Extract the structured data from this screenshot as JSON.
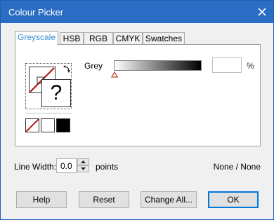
{
  "window": {
    "title": "Colour Picker"
  },
  "tabs": [
    {
      "label": "Greyscale",
      "active": true
    },
    {
      "label": "HSB",
      "active": false
    },
    {
      "label": "RGB",
      "active": false
    },
    {
      "label": "CMYK",
      "active": false
    },
    {
      "label": "Swatches",
      "active": false
    }
  ],
  "greyscale": {
    "grey_label": "Grey",
    "grey_value": "",
    "unit": "%",
    "preview_unknown": "?",
    "slider_position": 0.0
  },
  "line_width": {
    "label": "Line Width:",
    "value": "0.0",
    "unit": "points"
  },
  "status_text": "None / None",
  "buttons": {
    "help": "Help",
    "reset": "Reset",
    "change_all": "Change All...",
    "ok": "OK"
  },
  "colors": {
    "titlebar": "#2b6cc4",
    "active_tab_text": "#3c8fd4",
    "none_slash": "#b01818",
    "slider_marker": "#c0392b"
  }
}
